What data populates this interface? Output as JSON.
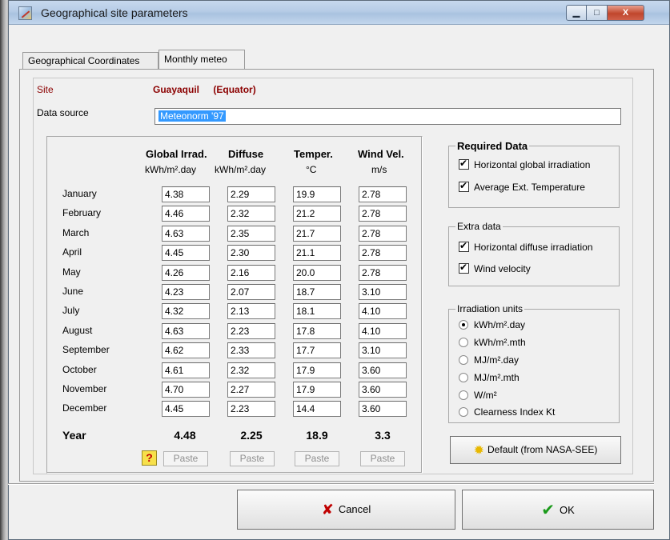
{
  "window": {
    "title": "Geographical site parameters",
    "controls": {
      "minimize": "▁",
      "maximize": "□",
      "close": "X"
    }
  },
  "tabs": [
    {
      "label": "Geographical Coordinates",
      "active": false
    },
    {
      "label": "Monthly meteo",
      "active": true
    }
  ],
  "site": {
    "label": "Site",
    "name": "Guayaquil",
    "country": "(Equator)"
  },
  "data_source": {
    "label": "Data source",
    "value": "Meteonorm '97"
  },
  "table": {
    "columns": [
      {
        "header": "Global Irrad.",
        "unit": "kWh/m².day"
      },
      {
        "header": "Diffuse",
        "unit": "kWh/m².day"
      },
      {
        "header": "Temper.",
        "unit": "°C"
      },
      {
        "header": "Wind Vel.",
        "unit": "m/s"
      }
    ],
    "rows": [
      {
        "month": "January",
        "values": [
          "4.38",
          "2.29",
          "19.9",
          "2.78"
        ]
      },
      {
        "month": "February",
        "values": [
          "4.46",
          "2.32",
          "21.2",
          "2.78"
        ]
      },
      {
        "month": "March",
        "values": [
          "4.63",
          "2.35",
          "21.7",
          "2.78"
        ]
      },
      {
        "month": "April",
        "values": [
          "4.45",
          "2.30",
          "21.1",
          "2.78"
        ]
      },
      {
        "month": "May",
        "values": [
          "4.26",
          "2.16",
          "20.0",
          "2.78"
        ]
      },
      {
        "month": "June",
        "values": [
          "4.23",
          "2.07",
          "18.7",
          "3.10"
        ]
      },
      {
        "month": "July",
        "values": [
          "4.32",
          "2.13",
          "18.1",
          "4.10"
        ]
      },
      {
        "month": "August",
        "values": [
          "4.63",
          "2.23",
          "17.8",
          "4.10"
        ]
      },
      {
        "month": "September",
        "values": [
          "4.62",
          "2.33",
          "17.7",
          "3.10"
        ]
      },
      {
        "month": "October",
        "values": [
          "4.61",
          "2.32",
          "17.9",
          "3.60"
        ]
      },
      {
        "month": "November",
        "values": [
          "4.70",
          "2.27",
          "17.9",
          "3.60"
        ]
      },
      {
        "month": "December",
        "values": [
          "4.45",
          "2.23",
          "14.4",
          "3.60"
        ]
      }
    ],
    "year": {
      "label": "Year",
      "values": [
        "4.48",
        "2.25",
        "18.9",
        "3.3"
      ]
    },
    "paste_label": "Paste",
    "help_label": "?"
  },
  "required_data": {
    "title": "Required Data",
    "items": [
      {
        "label": "Horizontal global irradiation",
        "checked": true
      },
      {
        "label": "Average Ext. Temperature",
        "checked": true
      }
    ]
  },
  "extra_data": {
    "title": "Extra data",
    "items": [
      {
        "label": "Horizontal diffuse irradiation",
        "checked": true
      },
      {
        "label": "Wind velocity",
        "checked": true
      }
    ]
  },
  "irradiation_units": {
    "title": "Irradiation units",
    "options": [
      {
        "label": "kWh/m².day",
        "selected": true
      },
      {
        "label": "kWh/m².mth",
        "selected": false
      },
      {
        "label": "MJ/m².day",
        "selected": false
      },
      {
        "label": "MJ/m².mth",
        "selected": false
      },
      {
        "label": "W/m²",
        "selected": false
      },
      {
        "label": "Clearness Index Kt",
        "selected": false
      }
    ]
  },
  "default_button": {
    "label": "Default (from NASA-SEE)"
  },
  "buttons": {
    "cancel": "Cancel",
    "ok": "OK"
  },
  "colors": {
    "site_text": "#8b0000",
    "cancel_icon": "#c00000",
    "ok_icon": "#1a9a1a",
    "selection": "#3399ff"
  }
}
